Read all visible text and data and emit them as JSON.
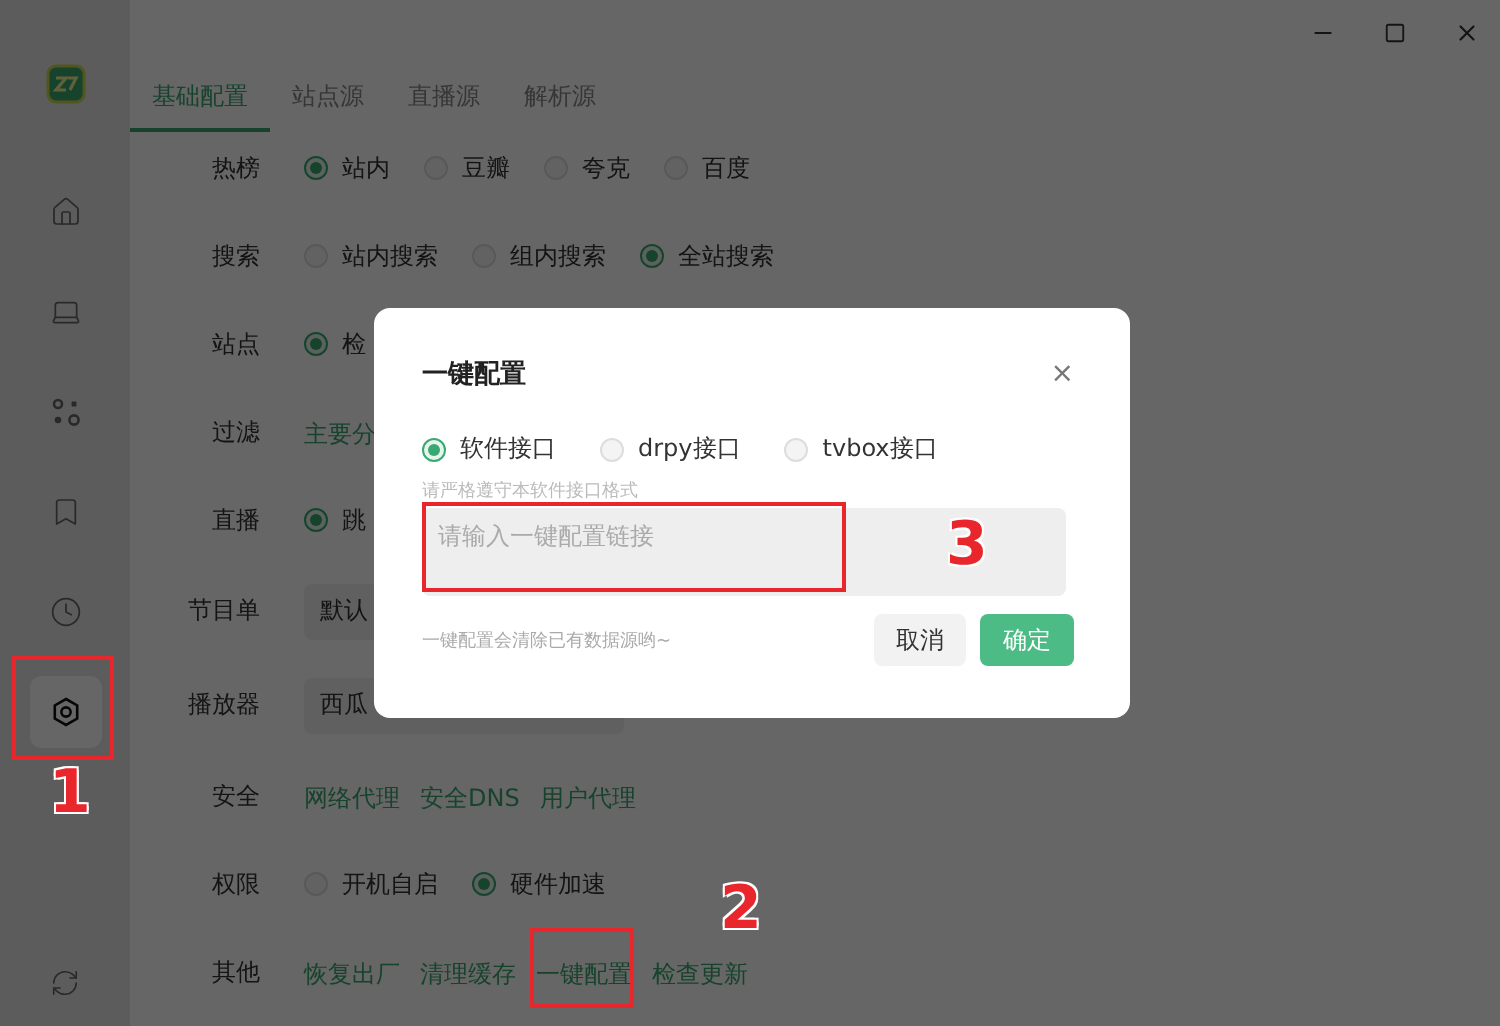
{
  "sidebar": {
    "items": [
      {
        "selected": false
      },
      {
        "selected": false
      },
      {
        "selected": false
      },
      {
        "selected": false
      },
      {
        "selected": false
      },
      {
        "selected": true,
        "annotation": "1"
      }
    ]
  },
  "tabs": [
    {
      "label": "基础配置",
      "selected": true
    },
    {
      "label": "站点源",
      "selected": false
    },
    {
      "label": "直播源",
      "selected": false
    },
    {
      "label": "解析源",
      "selected": false
    }
  ],
  "settings": [
    {
      "label": "热榜",
      "kind": "radios",
      "options": [
        {
          "label": "站内",
          "selected": true
        },
        {
          "label": "豆瓣",
          "selected": false
        },
        {
          "label": "夸克",
          "selected": false
        },
        {
          "label": "百度",
          "selected": false
        }
      ]
    },
    {
      "label": "搜索",
      "kind": "radios",
      "options": [
        {
          "label": "站内搜索",
          "selected": false
        },
        {
          "label": "组内搜索",
          "selected": false
        },
        {
          "label": "全站搜索",
          "selected": true
        }
      ]
    },
    {
      "label": "站点",
      "kind": "radios",
      "options": [
        {
          "label": "检",
          "selected": true
        }
      ]
    },
    {
      "label": "过滤",
      "kind": "links",
      "links": [
        {
          "label": "主要分"
        }
      ]
    },
    {
      "label": "直播",
      "kind": "radios",
      "options": [
        {
          "label": "跳",
          "selected": true
        }
      ]
    },
    {
      "label": "节目单",
      "kind": "select",
      "value": "默认"
    },
    {
      "label": "播放器",
      "kind": "select",
      "value": "西瓜"
    },
    {
      "label": "安全",
      "kind": "links",
      "links": [
        {
          "label": "网络代理"
        },
        {
          "label": "安全DNS"
        },
        {
          "label": "用户代理"
        }
      ]
    },
    {
      "label": "权限",
      "kind": "radios",
      "options": [
        {
          "label": "开机自启",
          "selected": false
        },
        {
          "label": "硬件加速",
          "selected": true
        }
      ]
    },
    {
      "label": "其他",
      "kind": "links",
      "links": [
        {
          "label": "恢复出厂"
        },
        {
          "label": "清理缓存"
        },
        {
          "label": "一键配置",
          "annotation": "2"
        },
        {
          "label": "检查更新"
        }
      ]
    }
  ],
  "dialog": {
    "title": "一键配置",
    "close": "×",
    "options": [
      {
        "label": "软件接口",
        "selected": true
      },
      {
        "label": "drpy接口",
        "selected": false
      },
      {
        "label": "tvbox接口",
        "selected": false
      }
    ],
    "hint": "请严格遵守本软件接口格式",
    "field": {
      "placeholder": "请输入一键配置链接",
      "annotation": "3"
    },
    "note": "一键配置会清除已有数据源哟~",
    "buttons": [
      {
        "label": "取消",
        "kind": "secondary"
      },
      {
        "label": "确定",
        "kind": "primary"
      }
    ]
  }
}
